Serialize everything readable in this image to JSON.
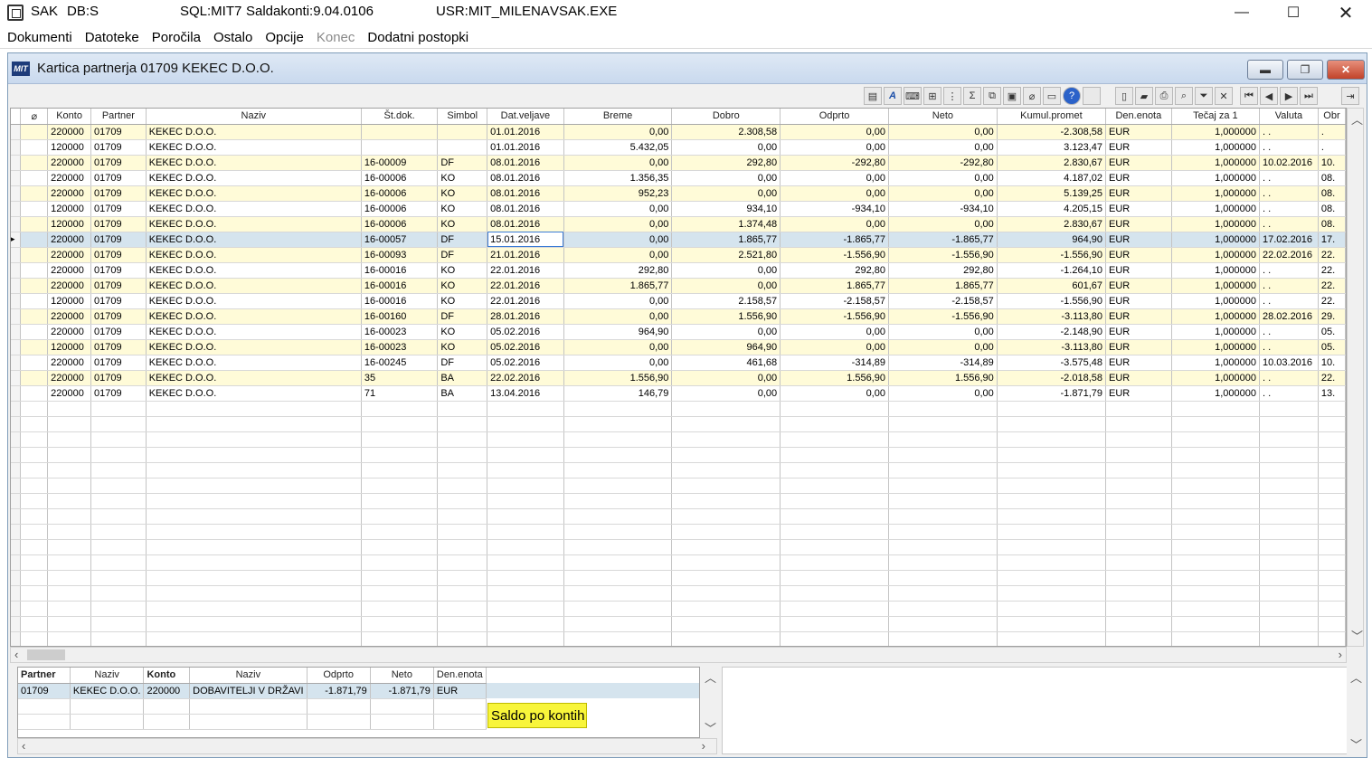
{
  "titlebar": {
    "app": "SAK",
    "db": "DB:S",
    "sql": "SQL:MIT7",
    "module": "Saldakonti:9.04.0106",
    "user": "USR:MIT_MILENA",
    "exe": "VSAK.EXE"
  },
  "menu": [
    "Dokumenti",
    "Datoteke",
    "Poročila",
    "Ostalo",
    "Opcije",
    "Konec",
    "Dodatni postopki"
  ],
  "menu_disabled": [
    "Konec"
  ],
  "child_window": {
    "title": "Kartica partnerja 01709 KEKEC D.O.O.",
    "logo": "MIT"
  },
  "toolbar_icons": [
    "document-icon",
    "font-icon",
    "keyboard-icon",
    "tree-icon",
    "group-icon",
    "sum-icon",
    "copy-icon",
    "window-icon",
    "attach-icon",
    "monitor-icon",
    "help-icon",
    "blank-icon",
    "page-icon",
    "folder-icon",
    "print-icon",
    "search-icon",
    "filter-icon",
    "clear-filter-icon",
    "first-icon",
    "prev-icon",
    "next-icon",
    "last-icon",
    "exit-icon"
  ],
  "grid": {
    "columns": [
      "Konto",
      "Partner",
      "Naziv",
      "Št.dok.",
      "Simbol",
      "Dat.veljave",
      "Breme",
      "Dobro",
      "Odprto",
      "Neto",
      "Kumul.promet",
      "Den.enota",
      "Tečaj za 1",
      "Valuta",
      "Obr"
    ],
    "rows": [
      [
        "220000",
        "01709",
        "KEKEC D.O.O.",
        "",
        "",
        "01.01.2016",
        "0,00",
        "2.308,58",
        "0,00",
        "0,00",
        "-2.308,58",
        "EUR",
        "1,000000",
        ". .",
        "."
      ],
      [
        "120000",
        "01709",
        "KEKEC D.O.O.",
        "",
        "",
        "01.01.2016",
        "5.432,05",
        "0,00",
        "0,00",
        "0,00",
        "3.123,47",
        "EUR",
        "1,000000",
        ". .",
        "."
      ],
      [
        "220000",
        "01709",
        "KEKEC D.O.O.",
        "16-00009",
        "DF",
        "08.01.2016",
        "0,00",
        "292,80",
        "-292,80",
        "-292,80",
        "2.830,67",
        "EUR",
        "1,000000",
        "10.02.2016",
        "10."
      ],
      [
        "220000",
        "01709",
        "KEKEC D.O.O.",
        "16-00006",
        "KO",
        "08.01.2016",
        "1.356,35",
        "0,00",
        "0,00",
        "0,00",
        "4.187,02",
        "EUR",
        "1,000000",
        ". .",
        "08."
      ],
      [
        "220000",
        "01709",
        "KEKEC D.O.O.",
        "16-00006",
        "KO",
        "08.01.2016",
        "952,23",
        "0,00",
        "0,00",
        "0,00",
        "5.139,25",
        "EUR",
        "1,000000",
        ". .",
        "08."
      ],
      [
        "120000",
        "01709",
        "KEKEC D.O.O.",
        "16-00006",
        "KO",
        "08.01.2016",
        "0,00",
        "934,10",
        "-934,10",
        "-934,10",
        "4.205,15",
        "EUR",
        "1,000000",
        ". .",
        "08."
      ],
      [
        "120000",
        "01709",
        "KEKEC D.O.O.",
        "16-00006",
        "KO",
        "08.01.2016",
        "0,00",
        "1.374,48",
        "0,00",
        "0,00",
        "2.830,67",
        "EUR",
        "1,000000",
        ". .",
        "08."
      ],
      [
        "220000",
        "01709",
        "KEKEC D.O.O.",
        "16-00057",
        "DF",
        "15.01.2016",
        "0,00",
        "1.865,77",
        "-1.865,77",
        "-1.865,77",
        "964,90",
        "EUR",
        "1,000000",
        "17.02.2016",
        "17."
      ],
      [
        "220000",
        "01709",
        "KEKEC D.O.O.",
        "16-00093",
        "DF",
        "21.01.2016",
        "0,00",
        "2.521,80",
        "-1.556,90",
        "-1.556,90",
        "-1.556,90",
        "EUR",
        "1,000000",
        "22.02.2016",
        "22."
      ],
      [
        "220000",
        "01709",
        "KEKEC D.O.O.",
        "16-00016",
        "KO",
        "22.01.2016",
        "292,80",
        "0,00",
        "292,80",
        "292,80",
        "-1.264,10",
        "EUR",
        "1,000000",
        ". .",
        "22."
      ],
      [
        "220000",
        "01709",
        "KEKEC D.O.O.",
        "16-00016",
        "KO",
        "22.01.2016",
        "1.865,77",
        "0,00",
        "1.865,77",
        "1.865,77",
        "601,67",
        "EUR",
        "1,000000",
        ". .",
        "22."
      ],
      [
        "120000",
        "01709",
        "KEKEC D.O.O.",
        "16-00016",
        "KO",
        "22.01.2016",
        "0,00",
        "2.158,57",
        "-2.158,57",
        "-2.158,57",
        "-1.556,90",
        "EUR",
        "1,000000",
        ". .",
        "22."
      ],
      [
        "220000",
        "01709",
        "KEKEC D.O.O.",
        "16-00160",
        "DF",
        "28.01.2016",
        "0,00",
        "1.556,90",
        "-1.556,90",
        "-1.556,90",
        "-3.113,80",
        "EUR",
        "1,000000",
        "28.02.2016",
        "29."
      ],
      [
        "220000",
        "01709",
        "KEKEC D.O.O.",
        "16-00023",
        "KO",
        "05.02.2016",
        "964,90",
        "0,00",
        "0,00",
        "0,00",
        "-2.148,90",
        "EUR",
        "1,000000",
        ". .",
        "05."
      ],
      [
        "120000",
        "01709",
        "KEKEC D.O.O.",
        "16-00023",
        "KO",
        "05.02.2016",
        "0,00",
        "964,90",
        "0,00",
        "0,00",
        "-3.113,80",
        "EUR",
        "1,000000",
        ". .",
        "05."
      ],
      [
        "220000",
        "01709",
        "KEKEC D.O.O.",
        "16-00245",
        "DF",
        "05.02.2016",
        "0,00",
        "461,68",
        "-314,89",
        "-314,89",
        "-3.575,48",
        "EUR",
        "1,000000",
        "10.03.2016",
        "10."
      ],
      [
        "220000",
        "01709",
        "KEKEC D.O.O.",
        "35",
        "BA",
        "22.02.2016",
        "1.556,90",
        "0,00",
        "1.556,90",
        "1.556,90",
        "-2.018,58",
        "EUR",
        "1,000000",
        ". .",
        "22."
      ],
      [
        "220000",
        "01709",
        "KEKEC D.O.O.",
        "71",
        "BA",
        "13.04.2016",
        "146,79",
        "0,00",
        "0,00",
        "0,00",
        "-1.871,79",
        "EUR",
        "1,000000",
        ". .",
        "13."
      ]
    ],
    "selected_row": 7
  },
  "summary": {
    "columns": [
      "Partner",
      "Naziv",
      "Konto",
      "Naziv",
      "Odprto",
      "Neto",
      "Den.enota"
    ],
    "rows": [
      [
        "01709",
        "KEKEC D.O.O.",
        "220000",
        "DOBAVITELJI V DRŽAVI",
        "-1.871,79",
        "-1.871,79",
        "EUR"
      ]
    ]
  },
  "tooltip": "Saldo po kontih"
}
